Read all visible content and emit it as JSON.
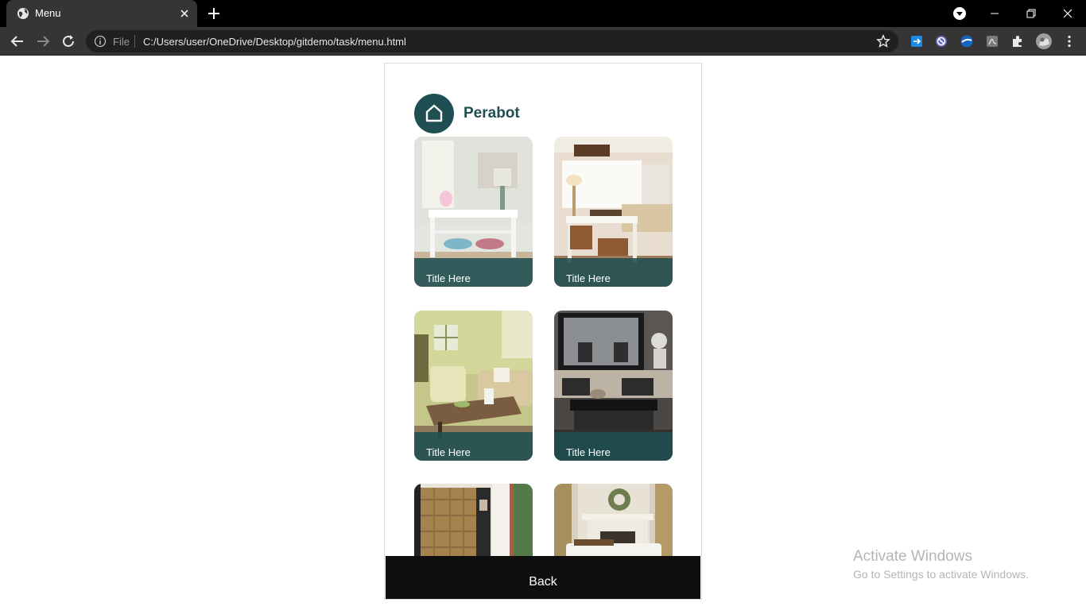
{
  "browser": {
    "tab_title": "Menu",
    "address_scheme_label": "File",
    "address_url": "C:/Users/user/OneDrive/Desktop/gitdemo/task/menu.html",
    "icons": [
      "globe-icon",
      "close-icon",
      "plus-icon",
      "profile-dropdown-icon",
      "minimize-icon",
      "restore-icon",
      "close-window-icon",
      "back-arrow-icon",
      "forward-arrow-icon",
      "reload-icon",
      "info-icon",
      "star-icon",
      "puzzle-icon",
      "avatar",
      "more-vert-icon"
    ]
  },
  "page": {
    "brand": "Perabot",
    "accent_color": "#1f4f52",
    "cards": [
      {
        "title": "Title Here",
        "scene": "console table with lamp"
      },
      {
        "title": "Title Here",
        "scene": "sofa table with baskets"
      },
      {
        "title": "Title Here",
        "scene": "green living room"
      },
      {
        "title": "Title Here",
        "scene": "dark living room with mirror"
      },
      {
        "title": "",
        "scene": "rattan cabinet"
      },
      {
        "title": "",
        "scene": "fireplace with wreath"
      }
    ],
    "back_label": "Back"
  },
  "watermark": {
    "title": "Activate Windows",
    "subtitle": "Go to Settings to activate Windows."
  }
}
